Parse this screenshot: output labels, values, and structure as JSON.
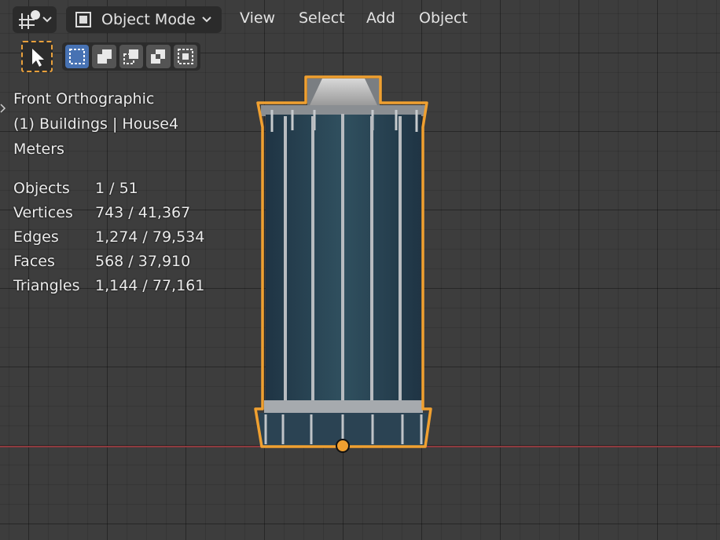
{
  "header": {
    "editor_type_icon": "object-transform-icon",
    "mode_label": "Object Mode",
    "menus": [
      "View",
      "Select",
      "Add",
      "Object"
    ]
  },
  "overlay": {
    "view_name": "Front Orthographic",
    "collection_object": "(1) Buildings | House4",
    "units": "Meters"
  },
  "stats": [
    {
      "label": "Objects",
      "value": "1 / 51"
    },
    {
      "label": "Vertices",
      "value": "743 / 41,367"
    },
    {
      "label": "Edges",
      "value": "1,274 / 79,534"
    },
    {
      "label": "Faces",
      "value": "568 / 37,910"
    },
    {
      "label": "Triangles",
      "value": "1,144 / 77,161"
    }
  ],
  "colors": {
    "selection_outline": "#f0a030",
    "x_axis": "#8e3b3f",
    "active_tool": "#4772b3",
    "building_body": "#2d4a5c",
    "building_frame": "#b8bcc0"
  }
}
